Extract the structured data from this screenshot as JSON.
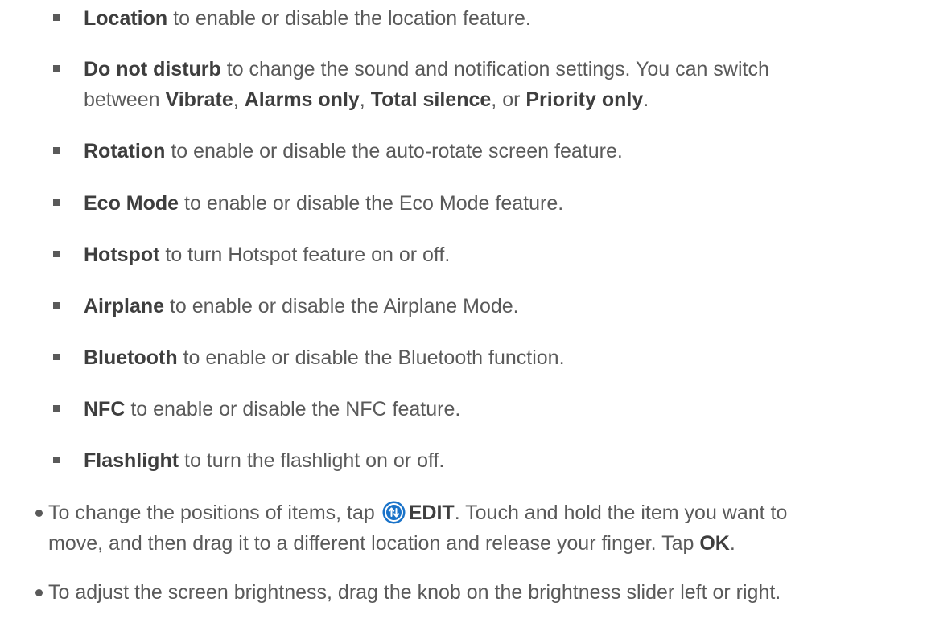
{
  "sub_items": [
    {
      "term": "Location",
      "rest": " to enable or disable the location feature."
    },
    {
      "term": "Do not disturb",
      "rest": " to change the sound and notification settings. You can switch",
      "line2": {
        "prefix": "between ",
        "opt1": "Vibrate",
        "sep1": ", ",
        "opt2": "Alarms only",
        "sep2": ", ",
        "opt3": "Total silence",
        "sep3": ", or ",
        "opt4": "Priority only",
        "suffix": "."
      }
    },
    {
      "term": "Rotation",
      "rest": " to enable or disable the auto-rotate screen feature."
    },
    {
      "term": "Eco Mode",
      "rest": " to enable or disable the Eco Mode feature."
    },
    {
      "term": "Hotspot",
      "rest": " to turn Hotspot feature on or off."
    },
    {
      "term": "Airplane",
      "rest": " to enable or disable the Airplane Mode."
    },
    {
      "term": "Bluetooth",
      "rest": " to enable or disable the Bluetooth function."
    },
    {
      "term": "NFC",
      "rest": " to enable or disable the NFC feature."
    },
    {
      "term": "Flashlight",
      "rest": " to turn the flashlight on or off."
    }
  ],
  "main_items": [
    {
      "line1_prefix": "To change the positions of items, tap ",
      "edit_label": "EDIT",
      "line1_suffix": ". Touch and hold the item you want to",
      "line2_prefix": "move, and then drag it to a different location and release your finger. Tap ",
      "ok_label": "OK",
      "line2_suffix": "."
    },
    {
      "text": "To adjust the screen brightness, drag the knob on the brightness slider left or right."
    }
  ],
  "icon": {
    "edit": "edit-arrows-icon",
    "color": "#1a73c9"
  }
}
